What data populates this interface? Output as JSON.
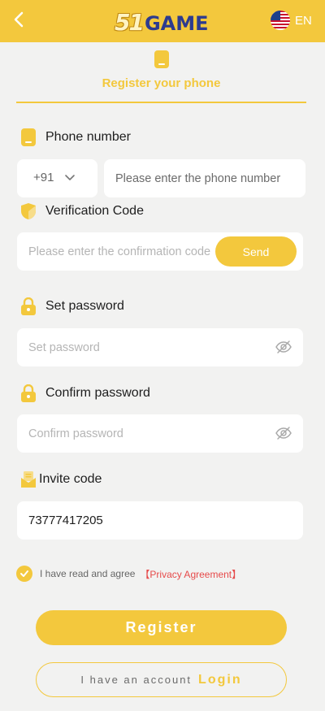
{
  "header": {
    "back_icon": "chevron-left-icon",
    "logo_number": "51",
    "logo_word": "GAME",
    "language_flag": "us-flag-icon",
    "language": "EN"
  },
  "tab": {
    "icon": "phone-icon",
    "label": "Register your phone"
  },
  "phone": {
    "label": "Phone number",
    "icon": "phone-icon",
    "country_code": "+91",
    "placeholder": "Please enter the phone number"
  },
  "verification": {
    "label": "Verification Code",
    "icon": "shield-icon",
    "placeholder": "Please enter the confirmation code",
    "send_label": "Send"
  },
  "password": {
    "label": "Set password",
    "icon": "lock-icon",
    "placeholder": "Set password"
  },
  "confirm_password": {
    "label": "Confirm password",
    "icon": "lock-icon",
    "placeholder": "Confirm password"
  },
  "invite": {
    "label": "Invite code",
    "icon": "invite-icon",
    "value": "73777417205"
  },
  "agreement": {
    "checked": true,
    "text": "I have read and agree",
    "link": "【Privacy Agreement】"
  },
  "buttons": {
    "register": "Register",
    "login_prefix": "I have an account",
    "login": "Login"
  },
  "colors": {
    "accent": "#f3c83d",
    "link": "#e64a4a",
    "background": "#f2f2f1"
  }
}
